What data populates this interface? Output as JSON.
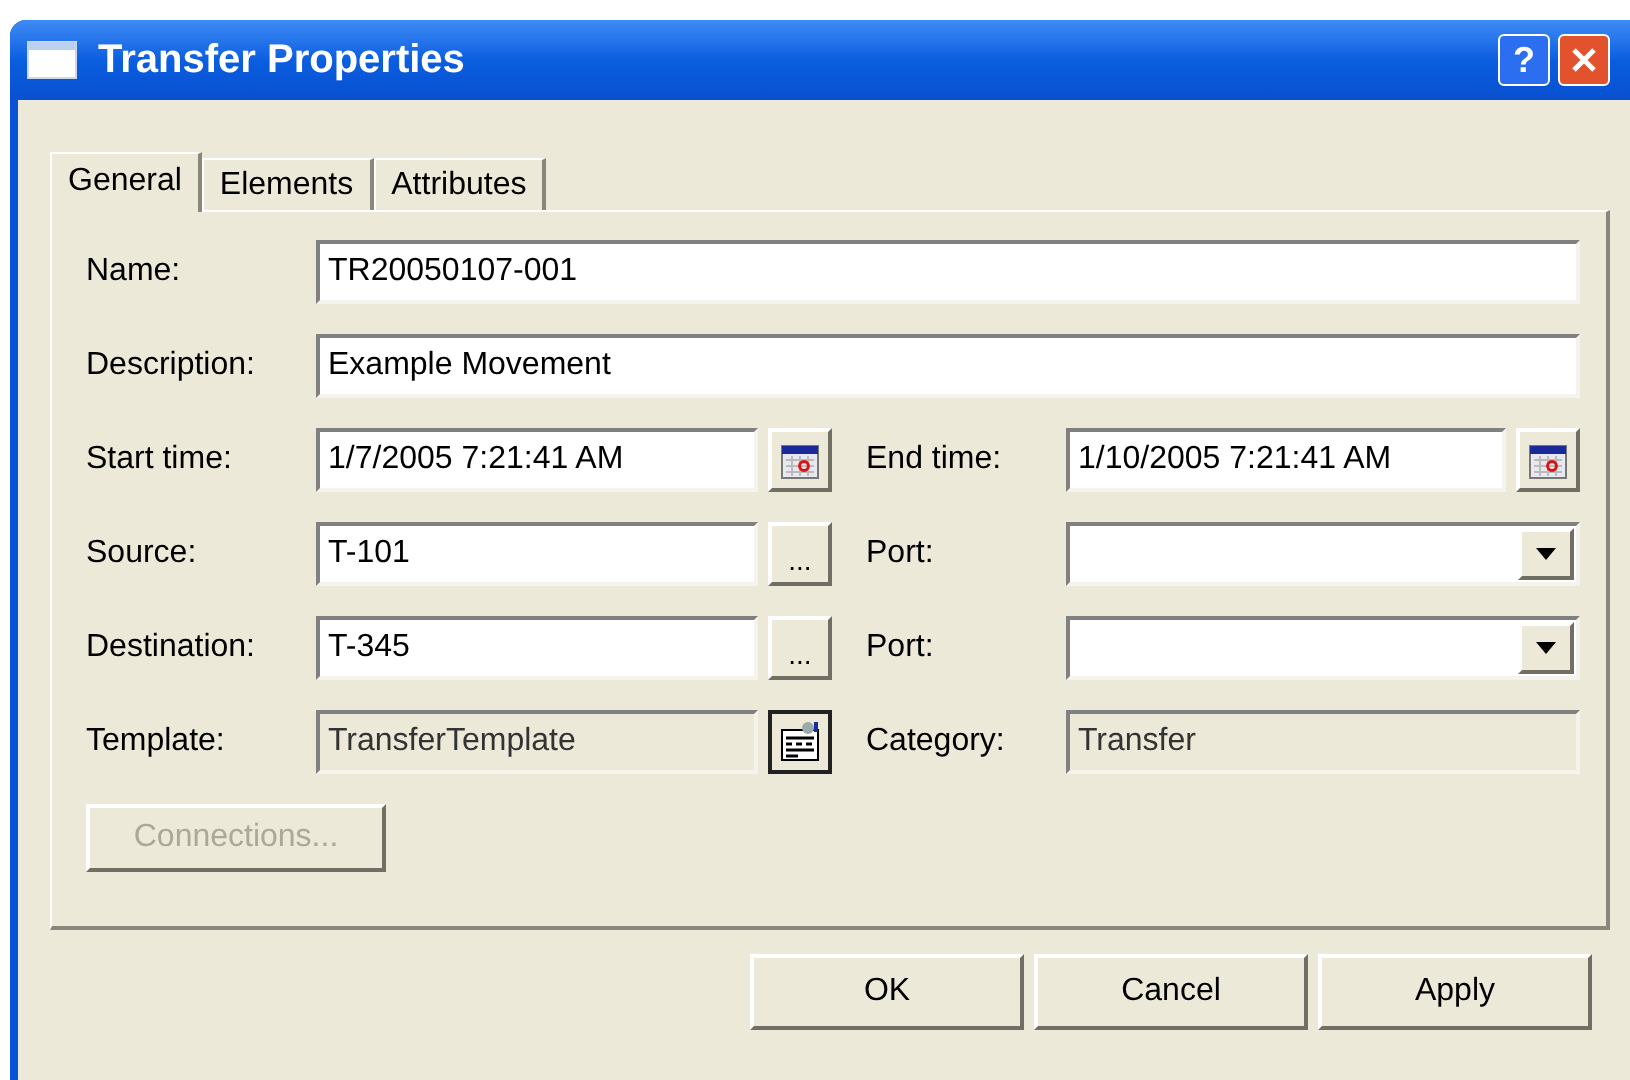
{
  "window": {
    "title": "Transfer Properties",
    "help_button": "?"
  },
  "tabs": [
    {
      "label": "General",
      "selected": true
    },
    {
      "label": "Elements",
      "selected": false
    },
    {
      "label": "Attributes",
      "selected": false
    }
  ],
  "rows": [
    {
      "kind": "wide",
      "items": [
        {
          "kind": "text",
          "label": "Name:",
          "value": "TR20050107-001"
        }
      ]
    },
    {
      "kind": "wide",
      "items": [
        {
          "kind": "text",
          "label": "Description:",
          "value": "Example Movement"
        }
      ]
    },
    {
      "kind": "split",
      "items": [
        {
          "kind": "date",
          "label": "Start time:",
          "value": "1/7/2005 7:21:41 AM"
        },
        {
          "kind": "date",
          "label": "End time:",
          "value": "1/10/2005 7:21:41 AM"
        }
      ]
    },
    {
      "kind": "split",
      "items": [
        {
          "kind": "browse",
          "label": "Source:",
          "value": "T-101",
          "button": "..."
        },
        {
          "kind": "combo",
          "label": "Port:"
        }
      ]
    },
    {
      "kind": "split",
      "items": [
        {
          "kind": "browse",
          "label": "Destination:",
          "value": "T-345",
          "button": "..."
        },
        {
          "kind": "combo",
          "label": "Port:"
        }
      ]
    },
    {
      "kind": "split",
      "items": [
        {
          "kind": "template",
          "label": "Template:",
          "value": "TransferTemplate"
        },
        {
          "kind": "readonly",
          "label": "Category:",
          "value": "Transfer"
        }
      ]
    }
  ],
  "connections_button": {
    "label": "Connections...",
    "disabled": true
  },
  "buttons": [
    {
      "label": "OK"
    },
    {
      "label": "Cancel"
    },
    {
      "label": "Apply"
    }
  ]
}
